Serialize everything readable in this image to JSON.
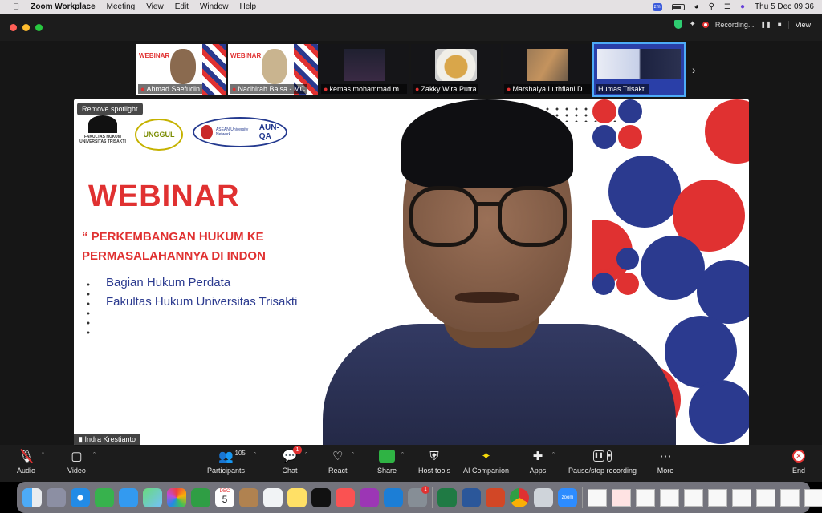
{
  "menubar": {
    "app_name": "Zoom Workplace",
    "items": [
      "Meeting",
      "View",
      "Edit",
      "Window",
      "Help"
    ],
    "zoom_badge": "zm",
    "clock": "Thu 5 Dec  09.36"
  },
  "window": {
    "recording_label": "Recording...",
    "view_label": "View"
  },
  "participants_strip": [
    {
      "name": "Ahmad Saefudin",
      "muted": true,
      "thumb_text": "WEBINAR"
    },
    {
      "name": "Nadhirah Baisa - MC",
      "muted": true,
      "thumb_text": "WEBINAR"
    },
    {
      "name": "kemas mohammad m...",
      "muted": true
    },
    {
      "name": "Zakky Wira Putra",
      "muted": true
    },
    {
      "name": "Marshalya Luthfiani D...",
      "muted": true
    },
    {
      "name": "Humas Trisakti",
      "muted": false
    }
  ],
  "stage": {
    "remove_spotlight": "Remove spotlight",
    "logos": {
      "faculty": "FAKULTAS HUKUM UNIVERSITAS TRISAKTI",
      "unggul": "UNGGUL",
      "asean_small": "ASEAN University Network",
      "aunqa": "AUN-QA"
    },
    "slide_title": "WEBINAR",
    "slide_line1": "“ PERKEMBANGAN HUKUM KE",
    "slide_line2": "PERMASALAHANNYA DI INDON",
    "dept_line1": "Bagian Hukum Perdata",
    "dept_line2": "Fakultas Hukum Universitas Trisakti",
    "speaker_name": "Indra Krestianto"
  },
  "toolbar": {
    "audio": "Audio",
    "video": "Video",
    "participants": "Participants",
    "participants_count": "105",
    "chat": "Chat",
    "chat_badge": "1",
    "react": "React",
    "share": "Share",
    "host_tools": "Host tools",
    "ai_companion": "AI Companion",
    "apps": "Apps",
    "pause_stop": "Pause/stop recording",
    "more": "More",
    "end": "End"
  },
  "dock": {
    "calendar_month": "DEC",
    "calendar_day": "5",
    "settings_badge": "1",
    "zoom_label": "zoom"
  },
  "colors": {
    "slide_red": "#e03131",
    "slide_blue": "#2b3a8f",
    "end_red": "#e03131",
    "share_green": "#2fb344"
  }
}
